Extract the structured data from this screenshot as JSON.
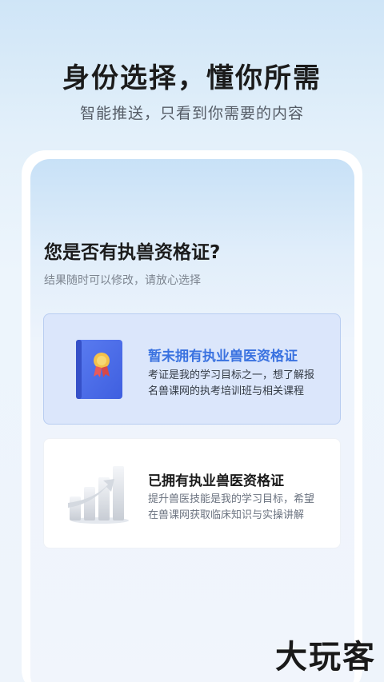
{
  "header": {
    "title": "身份选择，懂你所需",
    "subtitle": "智能推送，只看到你需要的内容"
  },
  "question": {
    "title": "您是否有执兽资格证?",
    "hint": "结果随时可以修改，请放心选择"
  },
  "options": [
    {
      "title": "暂未拥有执业兽医资格证",
      "desc": "考证是我的学习目标之一，想了解报名兽课网的执考培训班与相关课程",
      "icon": "certificate-book-icon",
      "selected": true
    },
    {
      "title": "已拥有执业兽医资格证",
      "desc": "提升兽医技能是我的学习目标，希望在兽课网获取临床知识与实操讲解",
      "icon": "growth-chart-icon",
      "selected": false
    }
  ],
  "watermark": "大玩客",
  "colors": {
    "accent": "#3a72e0",
    "selected_bg": "#dbe6fb",
    "selected_border": "#b8cdf1"
  }
}
